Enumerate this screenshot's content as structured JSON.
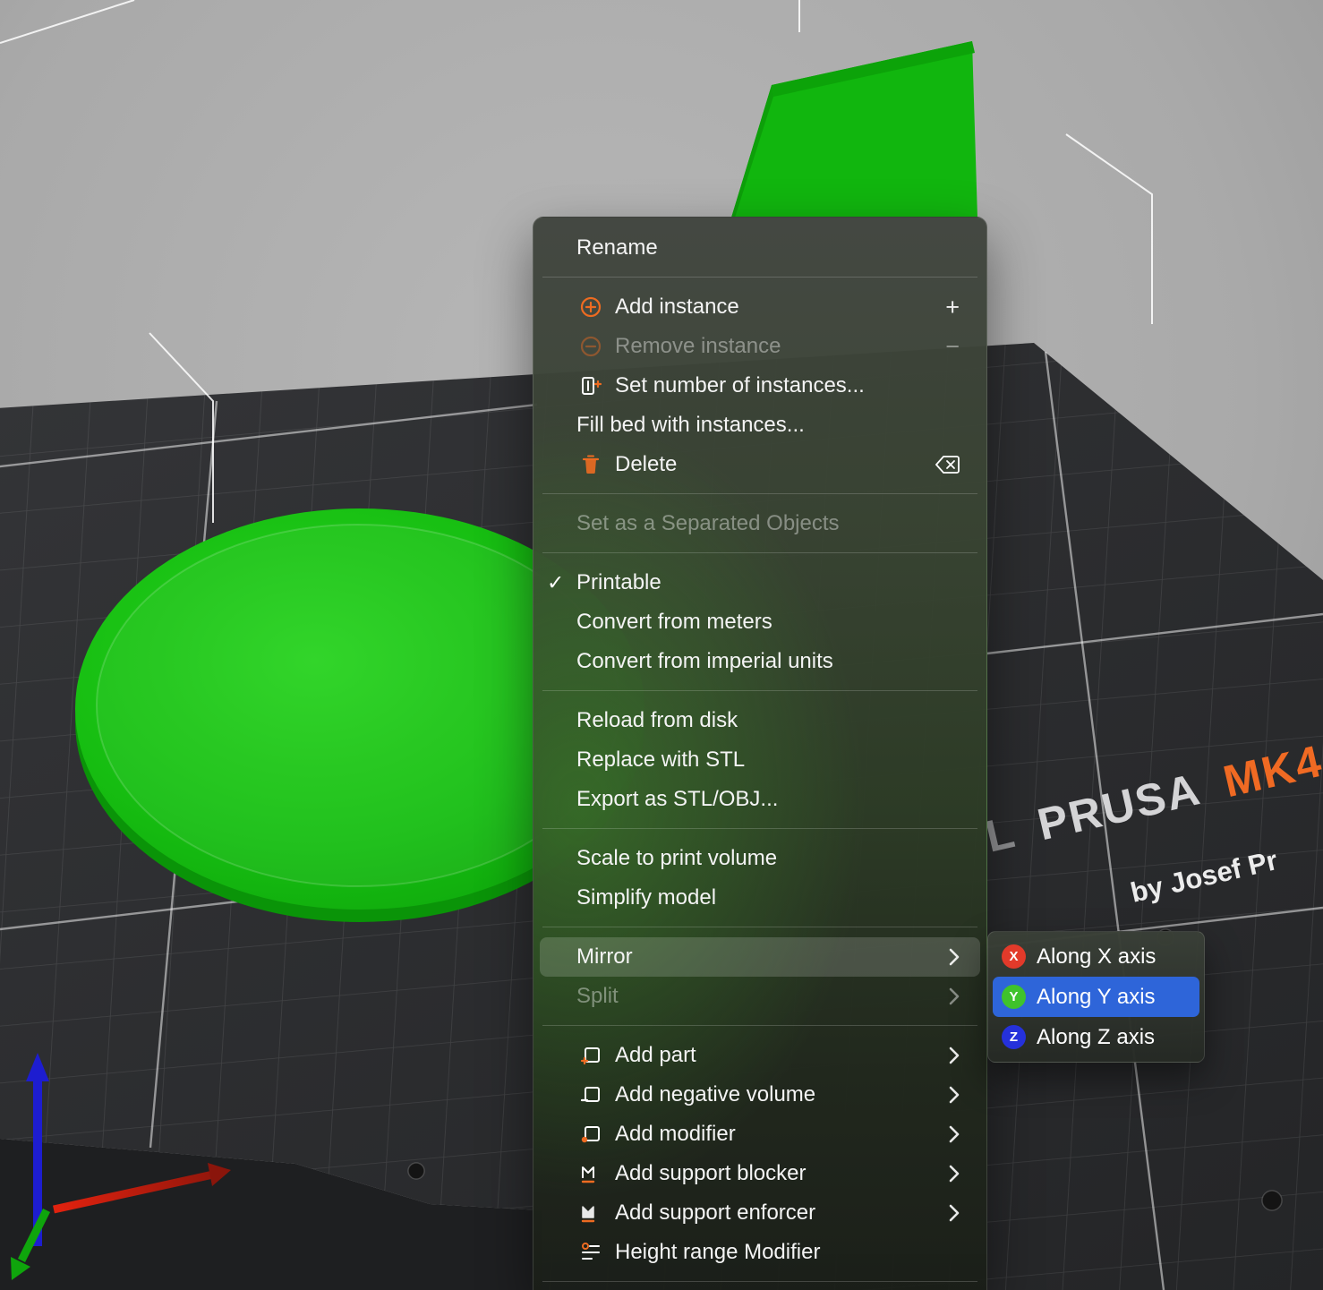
{
  "colors": {
    "accent_orange": "#ED6B21",
    "object_green": "#15BD11",
    "selection_blue": "#2E65D9",
    "axis_x_red": "#E23A2A",
    "axis_y_green": "#3FC32C",
    "axis_z_blue": "#2531DB"
  },
  "bed": {
    "brand_prefix": "L",
    "brand_name": "PRUSA",
    "brand_model": "MK4",
    "byline": "by Josef Pr"
  },
  "context_menu": {
    "items": [
      {
        "label": "Rename"
      },
      {
        "label": "Add instance",
        "accessory": "+"
      },
      {
        "label": "Remove instance",
        "accessory": "−",
        "disabled": true
      },
      {
        "label": "Set number of instances..."
      },
      {
        "label": "Fill bed with instances..."
      },
      {
        "label": "Delete"
      },
      {
        "label": "Set as a Separated Objects",
        "disabled": true
      },
      {
        "label": "Printable",
        "checked": "✓"
      },
      {
        "label": "Convert from meters"
      },
      {
        "label": "Convert from imperial units"
      },
      {
        "label": "Reload from disk"
      },
      {
        "label": "Replace with STL"
      },
      {
        "label": "Export as STL/OBJ..."
      },
      {
        "label": "Scale to print volume"
      },
      {
        "label": "Simplify model"
      },
      {
        "label": "Mirror",
        "highlighted": true
      },
      {
        "label": "Split",
        "disabled": true
      },
      {
        "label": "Add part"
      },
      {
        "label": "Add negative volume"
      },
      {
        "label": "Add modifier"
      },
      {
        "label": "Add support blocker"
      },
      {
        "label": "Add support enforcer"
      },
      {
        "label": "Height range Modifier"
      }
    ]
  },
  "mirror_submenu": {
    "items": [
      {
        "label": "Along X axis",
        "axis": "X",
        "color": "#E23A2A"
      },
      {
        "label": "Along Y axis",
        "axis": "Y",
        "color": "#3FC32C",
        "selected": true
      },
      {
        "label": "Along Z axis",
        "axis": "Z",
        "color": "#2531DB"
      }
    ]
  }
}
